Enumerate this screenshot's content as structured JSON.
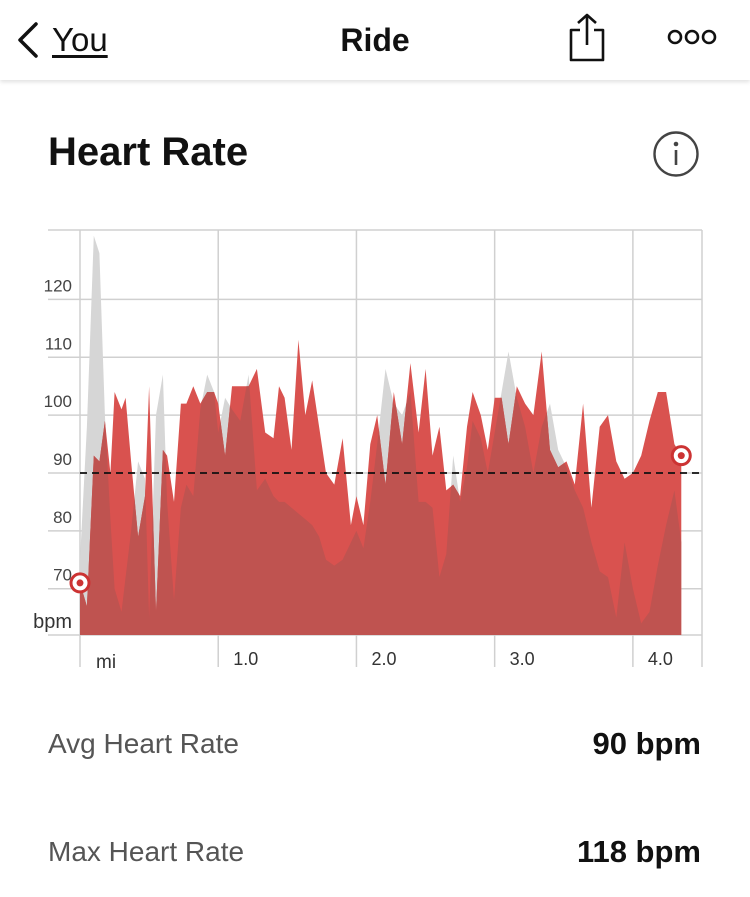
{
  "nav": {
    "back_label": "You",
    "title": "Ride"
  },
  "section": {
    "title": "Heart Rate"
  },
  "chart_data": {
    "type": "area",
    "x_unit": "mi",
    "y_unit": "bpm",
    "xlim": [
      0,
      4.5
    ],
    "ylim": [
      62,
      132
    ],
    "y_ticks": [
      70,
      80,
      90,
      100,
      110,
      120
    ],
    "x_ticks": [
      1.0,
      2.0,
      3.0,
      4.0
    ],
    "x_tick_labels": [
      "1.0",
      "2.0",
      "3.0",
      "4.0"
    ],
    "average_line": 90,
    "grid": true,
    "x": [
      0,
      0.05,
      0.1,
      0.14,
      0.18,
      0.22,
      0.25,
      0.3,
      0.33,
      0.37,
      0.42,
      0.47,
      0.5,
      0.55,
      0.6,
      0.63,
      0.68,
      0.73,
      0.77,
      0.82,
      0.87,
      0.92,
      0.97,
      1.0,
      1.05,
      1.1,
      1.16,
      1.22,
      1.28,
      1.34,
      1.4,
      1.44,
      1.48,
      1.53,
      1.58,
      1.63,
      1.68,
      1.73,
      1.78,
      1.84,
      1.9,
      1.96,
      2.0,
      2.05,
      2.1,
      2.15,
      2.21,
      2.27,
      2.33,
      2.39,
      2.45,
      2.5,
      2.55,
      2.6,
      2.65,
      2.7,
      2.75,
      2.8,
      2.84,
      2.9,
      2.95,
      3.0,
      3.05,
      3.1,
      3.16,
      3.22,
      3.28,
      3.34,
      3.4,
      3.46,
      3.52,
      3.58,
      3.64,
      3.7,
      3.76,
      3.82,
      3.88,
      3.94,
      4.0,
      4.06,
      4.12,
      4.18,
      4.24,
      4.3,
      4.35
    ],
    "series": [
      {
        "values": [
          71,
          67,
          93,
          92,
          99,
          90,
          104,
          101,
          103,
          92,
          79,
          86,
          105,
          66,
          94,
          93,
          85,
          102,
          102,
          105,
          102,
          104,
          104,
          102,
          93,
          105,
          105,
          105,
          108,
          97,
          96,
          105,
          103,
          94,
          113,
          100,
          106,
          98,
          90,
          88,
          96,
          81,
          86,
          81,
          95,
          100,
          88,
          104,
          95,
          109,
          97,
          108,
          93,
          98,
          87,
          88,
          86,
          98,
          104,
          100,
          94,
          103,
          103,
          95,
          105,
          102,
          100,
          111,
          94,
          91,
          92,
          88,
          102,
          84,
          98,
          100,
          92,
          89,
          90,
          93,
          99,
          104,
          104,
          95,
          93
        ]
      },
      {
        "values": [
          75,
          98,
          131,
          128,
          100,
          82,
          70,
          66,
          72,
          80,
          92,
          89,
          65,
          100,
          107,
          85,
          68,
          84,
          88,
          86,
          101,
          107,
          104,
          97,
          103,
          101,
          99,
          107,
          87,
          89,
          86,
          85,
          85,
          84,
          83,
          82,
          81,
          79,
          75,
          74,
          75,
          78,
          80,
          77,
          85,
          95,
          108,
          102,
          100,
          104,
          85,
          85,
          84,
          72,
          76,
          93,
          85,
          91,
          99,
          96,
          90,
          97,
          104,
          111,
          103,
          98,
          90,
          98,
          102,
          94,
          91,
          87,
          84,
          78,
          73,
          72,
          65,
          78,
          70,
          64,
          66,
          74,
          81,
          87,
          78
        ]
      }
    ],
    "colors": {
      "series_1": "#d9524f",
      "series_2_fill": "#d6d6d6",
      "overlap": "#bf5350",
      "grid": "#d0d0d0",
      "endpoint_marker": "#cc3333"
    }
  },
  "stats": {
    "avg_label": "Avg Heart Rate",
    "avg_value": "90 bpm",
    "max_label": "Max Heart Rate",
    "max_value": "118 bpm"
  }
}
